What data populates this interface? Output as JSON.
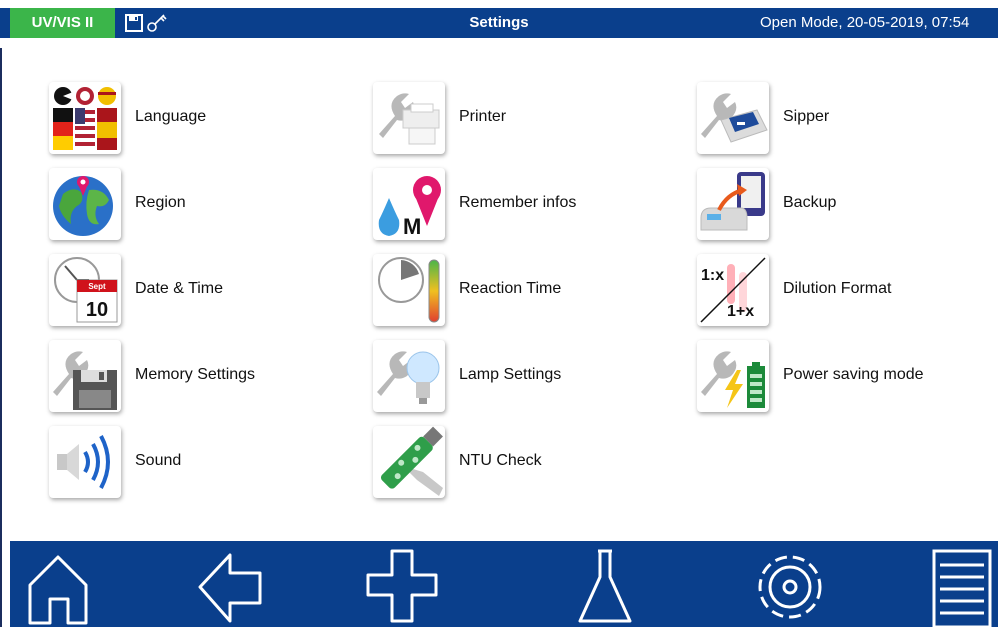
{
  "header": {
    "device": "UV/VIS II",
    "title": "Settings",
    "status": "Open Mode, 20-05-2019, 07:54"
  },
  "settings": [
    {
      "label": "Language",
      "icon": "language-flags-icon"
    },
    {
      "label": "Printer",
      "icon": "printer-wrench-icon"
    },
    {
      "label": "Sipper",
      "icon": "sipper-wrench-icon"
    },
    {
      "label": "Region",
      "icon": "globe-pin-icon"
    },
    {
      "label": "Remember infos",
      "icon": "drop-pin-m-icon"
    },
    {
      "label": "Backup",
      "icon": "backup-device-icon"
    },
    {
      "label": "Date & Time",
      "icon": "clock-calendar-icon",
      "calendar_month": "Sept",
      "calendar_day": "10"
    },
    {
      "label": "Reaction Time",
      "icon": "timer-tube-icon"
    },
    {
      "label": "Dilution Format",
      "icon": "dilution-ratio-icon",
      "ratio_a": "1:x",
      "ratio_b": "1+x"
    },
    {
      "label": "Memory Settings",
      "icon": "floppy-wrench-icon"
    },
    {
      "label": "Lamp Settings",
      "icon": "bulb-wrench-icon"
    },
    {
      "label": "Power saving mode",
      "icon": "battery-lightning-icon"
    },
    {
      "label": "Sound",
      "icon": "speaker-icon"
    },
    {
      "label": "NTU Check",
      "icon": "ntu-vial-icon"
    }
  ],
  "nav": [
    {
      "name": "home-button",
      "icon": "home-icon"
    },
    {
      "name": "back-button",
      "icon": "back-arrow-icon"
    },
    {
      "name": "add-button",
      "icon": "plus-icon"
    },
    {
      "name": "flask-button",
      "icon": "flask-icon"
    },
    {
      "name": "settings-button",
      "icon": "gear-icon"
    },
    {
      "name": "menu-button",
      "icon": "list-icon"
    }
  ],
  "colors": {
    "bar": "#0a3f8c",
    "badge": "#3bb54a"
  }
}
